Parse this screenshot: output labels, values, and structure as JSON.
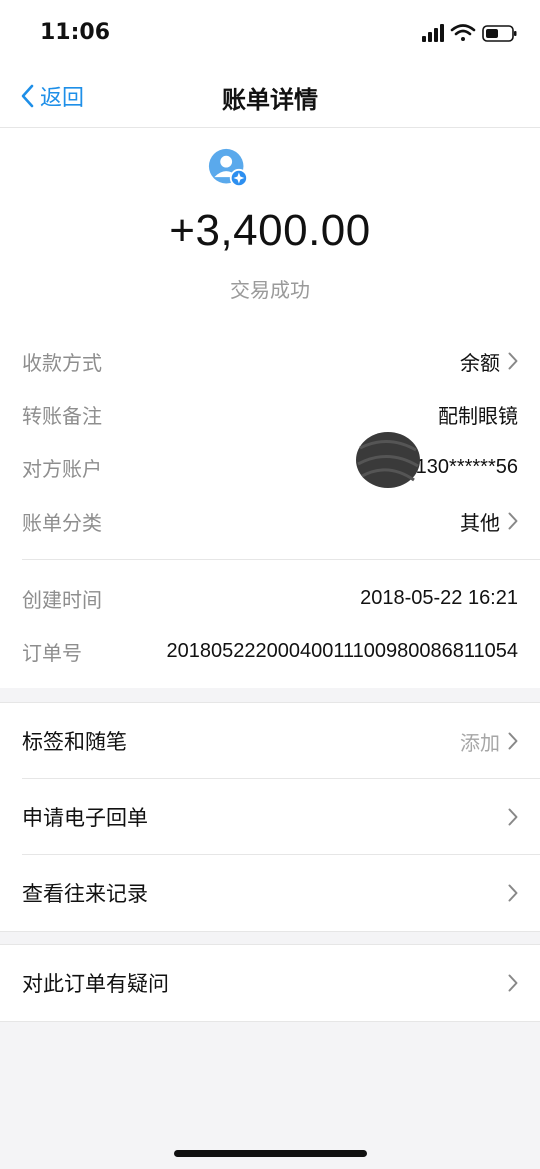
{
  "status_bar": {
    "time": "11:06"
  },
  "nav": {
    "back_label": "返回",
    "title": "账单详情"
  },
  "summary": {
    "amount": "+3,400.00",
    "status": "交易成功"
  },
  "details": [
    {
      "label": "收款方式",
      "value": "余额",
      "has_chevron": true
    },
    {
      "label": "转账备注",
      "value": "配制眼镜",
      "has_chevron": false
    },
    {
      "label": "对方账户",
      "value": "130******56",
      "has_chevron": false
    },
    {
      "label": "账单分类",
      "value": "其他",
      "has_chevron": true
    }
  ],
  "meta": [
    {
      "label": "创建时间",
      "value": "2018-05-22 16:21"
    },
    {
      "label": "订单号",
      "value": "20180522200040011100980086811054"
    }
  ],
  "actions": [
    {
      "label": "标签和随笔",
      "hint": "添加"
    },
    {
      "label": "申请电子回单",
      "hint": ""
    },
    {
      "label": "查看往来记录",
      "hint": ""
    }
  ],
  "support": {
    "label": "对此订单有疑问"
  },
  "colors": {
    "accent": "#1e8fe8",
    "muted": "#8e8e8e",
    "background": "#f4f4f6"
  }
}
